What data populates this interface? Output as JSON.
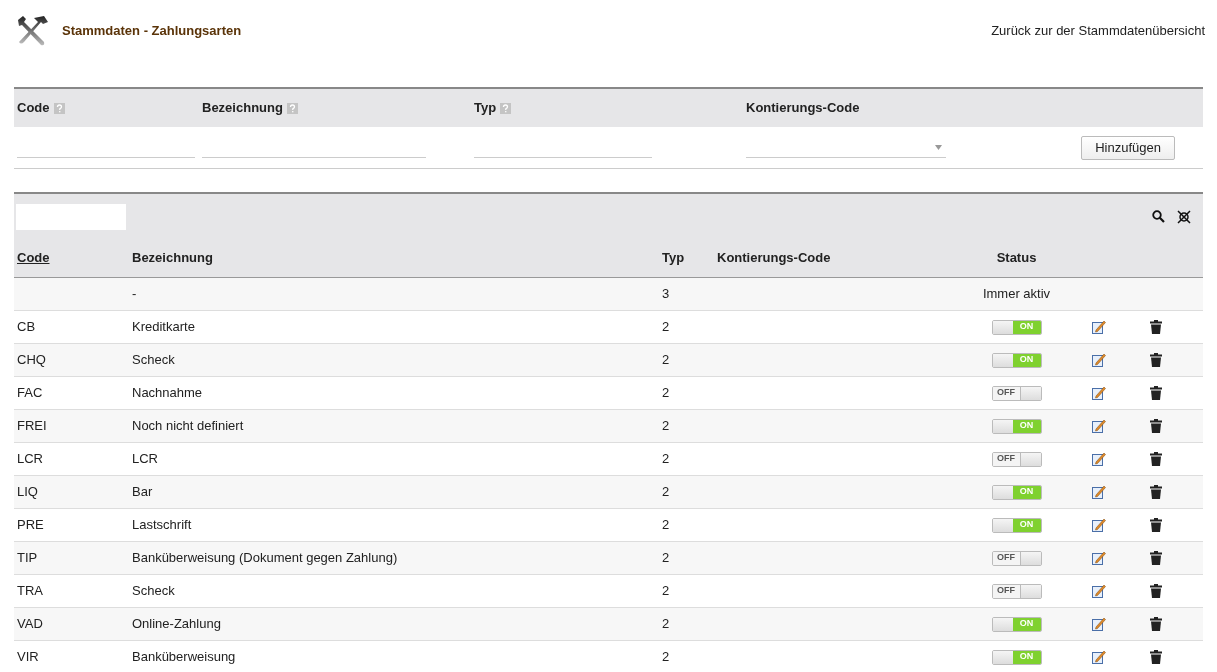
{
  "header": {
    "title": "Stammdaten - Zahlungsarten",
    "back_link": "Zurück zur der Stammdatenübersicht"
  },
  "form": {
    "fields": [
      {
        "label": "Code",
        "help": true,
        "kind": "text"
      },
      {
        "label": "Bezeichnung",
        "help": true,
        "kind": "text"
      },
      {
        "label": "Typ",
        "help": true,
        "kind": "text"
      },
      {
        "label": "Kontierungs-Code",
        "help": false,
        "kind": "select"
      }
    ],
    "add_button": "Hinzufügen"
  },
  "table": {
    "columns": [
      {
        "label": "Code",
        "sorted": true
      },
      {
        "label": "Bezeichnung",
        "sorted": false
      },
      {
        "label": "Typ",
        "sorted": false
      },
      {
        "label": "Kontierungs-Code",
        "sorted": false
      },
      {
        "label": "Status",
        "sorted": false
      }
    ],
    "rows": [
      {
        "kind": "fixed",
        "code": "",
        "name": "-",
        "typ": "3",
        "status_text": "Immer aktiv"
      },
      {
        "kind": "toggle",
        "code": "CB",
        "name": "Kreditkarte",
        "typ": "2",
        "on": true,
        "switch_label": "ON"
      },
      {
        "kind": "toggle",
        "code": "CHQ",
        "name": "Scheck",
        "typ": "2",
        "on": true,
        "switch_label": "ON"
      },
      {
        "kind": "toggle",
        "code": "FAC",
        "name": "Nachnahme",
        "typ": "2",
        "on": false,
        "switch_label": "OFF"
      },
      {
        "kind": "toggle",
        "code": "FREI",
        "name": "Noch nicht definiert",
        "typ": "2",
        "on": true,
        "switch_label": "ON"
      },
      {
        "kind": "toggle",
        "code": "LCR",
        "name": "LCR",
        "typ": "2",
        "on": false,
        "switch_label": "OFF"
      },
      {
        "kind": "toggle",
        "code": "LIQ",
        "name": "Bar",
        "typ": "2",
        "on": true,
        "switch_label": "ON"
      },
      {
        "kind": "toggle",
        "code": "PRE",
        "name": "Lastschrift",
        "typ": "2",
        "on": true,
        "switch_label": "ON"
      },
      {
        "kind": "toggle",
        "code": "TIP",
        "name": "Banküberweisung (Dokument gegen Zahlung)",
        "typ": "2",
        "on": false,
        "switch_label": "OFF"
      },
      {
        "kind": "toggle",
        "code": "TRA",
        "name": "Scheck",
        "typ": "2",
        "on": false,
        "switch_label": "OFF"
      },
      {
        "kind": "toggle",
        "code": "VAD",
        "name": "Online-Zahlung",
        "typ": "2",
        "on": true,
        "switch_label": "ON"
      },
      {
        "kind": "toggle",
        "code": "VIR",
        "name": "Banküberweisung",
        "typ": "2",
        "on": true,
        "switch_label": "ON"
      }
    ]
  }
}
